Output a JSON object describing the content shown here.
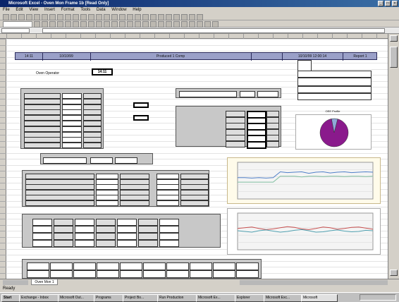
{
  "window": {
    "title": "Microsoft Excel - Oven Mon Frame 1b [Read Only]",
    "controls": [
      "_",
      "□",
      "×"
    ]
  },
  "menu": [
    "File",
    "Edit",
    "View",
    "Insert",
    "Format",
    "Tools",
    "Data",
    "Window",
    "Help"
  ],
  "banner": {
    "cell_a": "14:11",
    "cell_b": "10/10/99",
    "center": "Produced 1 Comp",
    "date_range": "10/10/99 12:00:14",
    "page": "Report 1"
  },
  "oven_operator_label": "Oven Operator",
  "oven_operator_value": "14:11",
  "sheet_tab": "Oven Mon 1",
  "status": "Ready",
  "taskbar": [
    "Start",
    "Exchange - Inbox",
    "Microsoft Out...",
    "Programs",
    "Project Bo...",
    "Run Production",
    "Microsoft Ex...",
    "Explorer",
    "Microsoft Exc...",
    "Microsoft"
  ],
  "pie_title": "OEE Profile",
  "pie_chart": {
    "type": "pie",
    "slices": [
      {
        "share": 0.93,
        "color": "#8a1a8c"
      },
      {
        "share": 0.07,
        "color": "#8fa8d8"
      }
    ]
  },
  "chart_data": [
    {
      "type": "line",
      "x": [
        0,
        1,
        2,
        3,
        4,
        5,
        6,
        7,
        8,
        9,
        10,
        11,
        12,
        13,
        14,
        15,
        16,
        17,
        18,
        19
      ],
      "ylim": [
        0,
        100
      ],
      "series": [
        {
          "color": "#4f7fc8",
          "values": [
            58,
            58,
            57,
            58,
            57,
            58,
            74,
            72,
            73,
            74,
            70,
            73,
            74,
            71,
            73,
            74,
            72,
            73,
            74,
            73
          ]
        },
        {
          "color": "#7fbfa0",
          "values": [
            46,
            46,
            46,
            46,
            46,
            46,
            62,
            62,
            62,
            60,
            62,
            62,
            61,
            62,
            62,
            61,
            62,
            62,
            61,
            62
          ]
        }
      ]
    },
    {
      "type": "line",
      "x": [
        0,
        1,
        2,
        3,
        4,
        5,
        6,
        7,
        8,
        9,
        10,
        11,
        12,
        13,
        14,
        15,
        16,
        17,
        18,
        19
      ],
      "ylim": [
        0,
        100
      ],
      "series": [
        {
          "color": "#c85050",
          "values": [
            58,
            60,
            62,
            58,
            55,
            57,
            60,
            63,
            61,
            57,
            55,
            58,
            62,
            60,
            56,
            58,
            61,
            62,
            59,
            56
          ]
        },
        {
          "color": "#4fa0b0",
          "values": [
            52,
            50,
            48,
            52,
            54,
            51,
            48,
            50,
            53,
            55,
            52,
            48,
            49,
            52,
            54,
            51,
            49,
            50,
            53,
            52
          ]
        }
      ]
    }
  ]
}
